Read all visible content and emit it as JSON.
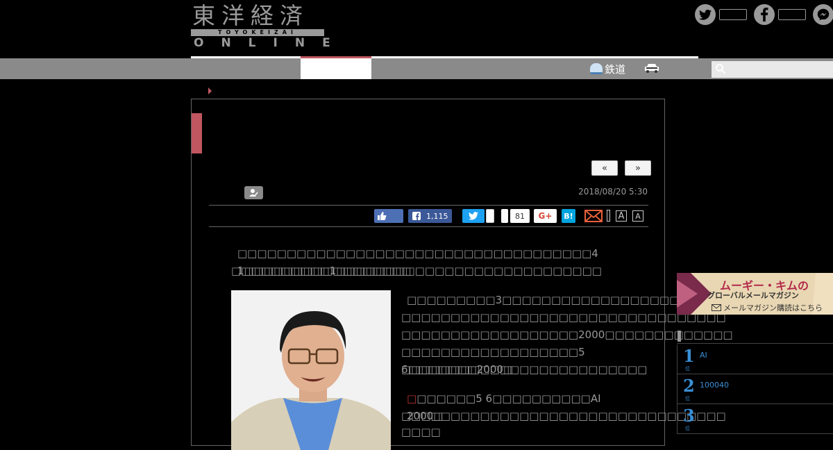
{
  "logo": {
    "kanji": "東洋経済",
    "band": "TOYOKEIZAI",
    "online": "ONLINE"
  },
  "nav": {
    "railway": "鉄道"
  },
  "search": {
    "placeholder": ""
  },
  "article": {
    "date": "2018/08/20 5:30",
    "pager_prev": "«",
    "pager_next": "»",
    "share": {
      "facebook_count": "1,115",
      "like_count": "81",
      "google": "G+",
      "hatena": "B!",
      "font_small": "A",
      "font_large": "A"
    },
    "paragraph1_line1": "4 1",
    "paragraph1_line2": "1",
    "paragraph2_line1": "3",
    "paragraph2_line3": "2000",
    "paragraph2_line4_a": "5 6",
    "paragraph2_line4_b": "2000",
    "paragraph3_line1_a": "5 6",
    "paragraph3_line1_b": "AI 2000"
  },
  "banner": {
    "line1": "ムーギー・キムの",
    "line2": "グローバルメールマガジン",
    "line3": "メールマガジン購読はこちら"
  },
  "ranking": [
    {
      "rank": "1",
      "suffix": "位",
      "text": "AI"
    },
    {
      "rank": "2",
      "suffix": "位",
      "text": "100040"
    },
    {
      "rank": "3",
      "suffix": "位",
      "text": ""
    }
  ],
  "colors": {
    "accent": "#c0565f",
    "nav": "#8a8a8a",
    "rank_blue": "#3a8fd6"
  }
}
